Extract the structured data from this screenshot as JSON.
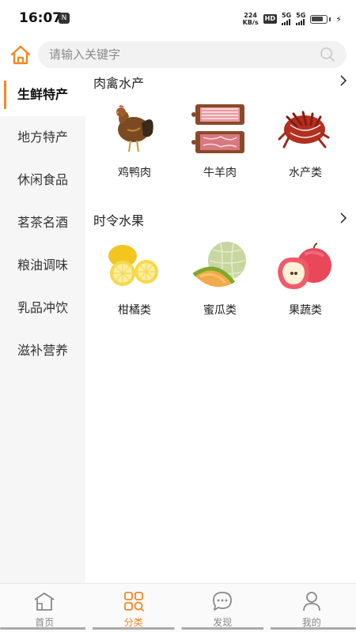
{
  "status_bar": {
    "time": "16:07",
    "app_icon": "N",
    "net_speed_value": "224",
    "net_speed_unit": "KB/s",
    "hd_label": "HD",
    "sim1_label": "5G",
    "sim2_label": "5G"
  },
  "search": {
    "placeholder": "请输入关键字"
  },
  "sidebar": {
    "items": [
      {
        "label": "生鲜特产",
        "active": true
      },
      {
        "label": "地方特产"
      },
      {
        "label": "休闲食品"
      },
      {
        "label": "茗茶名酒"
      },
      {
        "label": "粮油调味"
      },
      {
        "label": "乳品冲饮"
      },
      {
        "label": "滋补营养"
      }
    ]
  },
  "sections": [
    {
      "title": "肉禽水产",
      "items": [
        {
          "label": "鸡鸭肉",
          "icon": "chicken-image"
        },
        {
          "label": "牛羊肉",
          "icon": "meat-image"
        },
        {
          "label": "水产类",
          "icon": "seafood-image"
        }
      ]
    },
    {
      "title": "时令水果",
      "items": [
        {
          "label": "柑橘类",
          "icon": "lemon-image"
        },
        {
          "label": "蜜瓜类",
          "icon": "melon-image"
        },
        {
          "label": "果蔬类",
          "icon": "apple-image"
        }
      ]
    }
  ],
  "bottom_nav": {
    "items": [
      {
        "label": "首页",
        "icon": "home-icon"
      },
      {
        "label": "分类",
        "icon": "category-icon",
        "active": true
      },
      {
        "label": "发现",
        "icon": "chat-icon"
      },
      {
        "label": "我的",
        "icon": "user-icon"
      }
    ]
  },
  "colors": {
    "accent": "#f08a24",
    "sidebar_bg": "#f6f6f6",
    "search_bg": "#f2f2f2"
  }
}
